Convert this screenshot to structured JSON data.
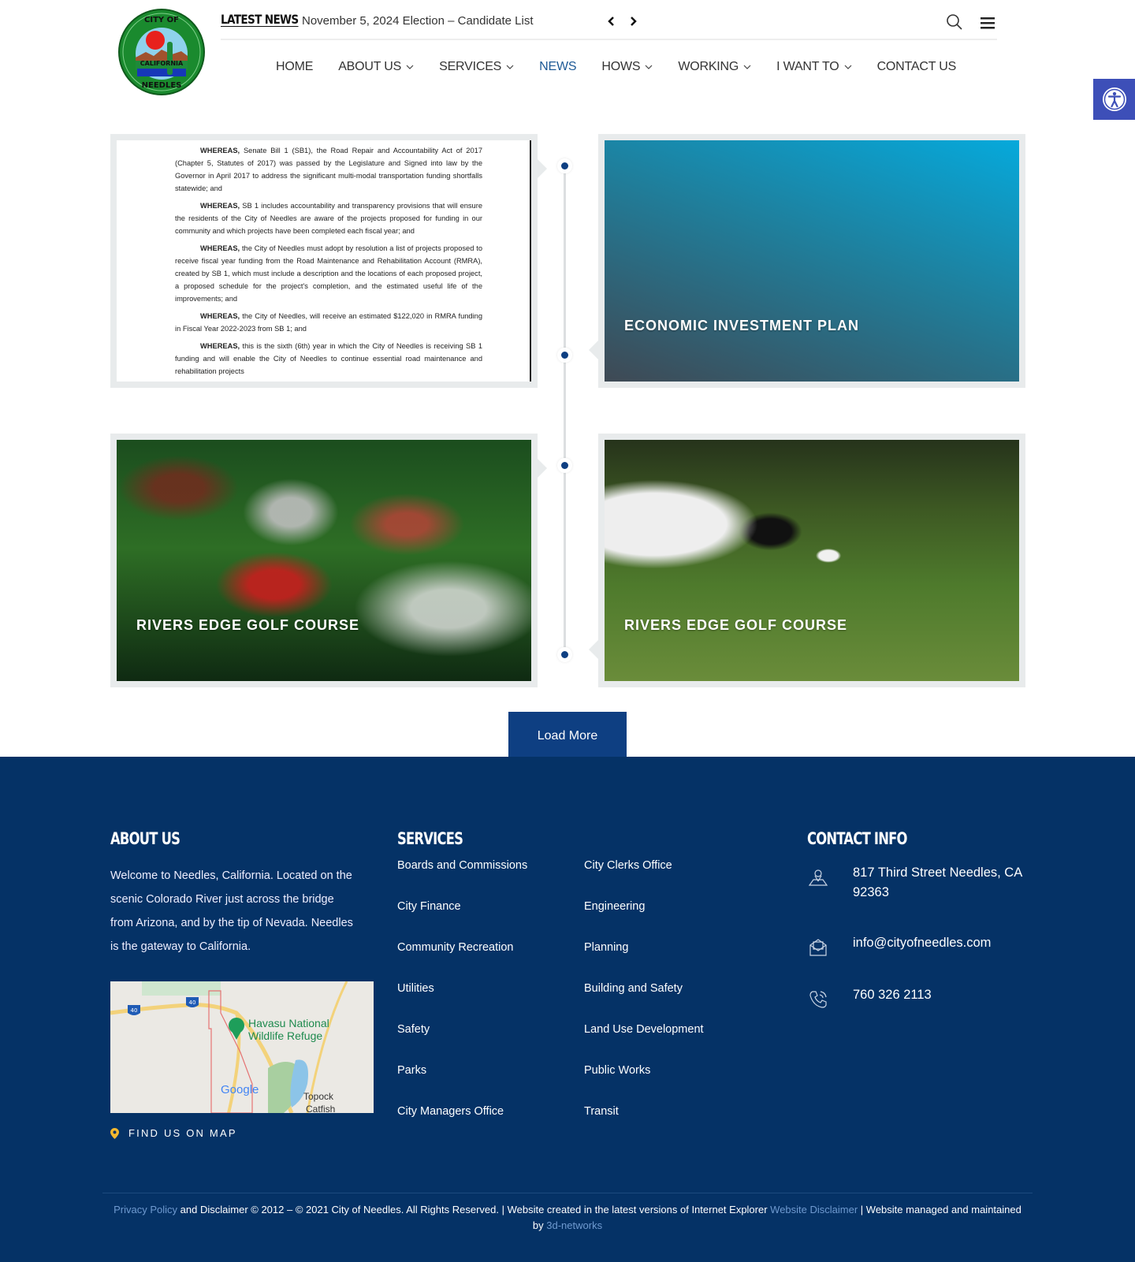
{
  "header": {
    "logo_alt": "City of Needles California seal",
    "ticker_label": "LATEST NEWS",
    "ticker_text": "November 5, 2024 Election – Candidate List"
  },
  "nav": {
    "items": [
      {
        "label": "HOME",
        "has_dropdown": false,
        "active": false
      },
      {
        "label": "ABOUT US",
        "has_dropdown": true,
        "active": false
      },
      {
        "label": "SERVICES",
        "has_dropdown": true,
        "active": false
      },
      {
        "label": "NEWS",
        "has_dropdown": false,
        "active": true
      },
      {
        "label": "HOWS",
        "has_dropdown": true,
        "active": false
      },
      {
        "label": "WORKING",
        "has_dropdown": true,
        "active": false
      },
      {
        "label": "I WANT TO",
        "has_dropdown": true,
        "active": false
      },
      {
        "label": "CONTACT US",
        "has_dropdown": false,
        "active": false
      }
    ]
  },
  "timeline": {
    "cards": [
      {
        "title": "",
        "type": "document",
        "paragraphs": [
          {
            "lead": "WHEREAS,",
            "text": " Senate Bill 1 (SB1), the Road Repair and Accountability Act of 2017 (Chapter 5, Statutes of 2017) was passed by the Legislature and Signed into law by the Governor in April 2017 to address the significant multi-modal transportation funding shortfalls statewide; and"
          },
          {
            "lead": "WHEREAS,",
            "text": " SB 1 includes accountability and transparency provisions that will ensure the residents of the City of Needles are aware of the projects proposed for funding in our community and which projects have been completed each fiscal year; and"
          },
          {
            "lead": "WHEREAS,",
            "text": " the City of Needles must adopt by resolution a list of projects proposed to receive fiscal year funding from the Road Maintenance and Rehabilitation Account (RMRA), created by SB 1, which must include a description and the locations of each proposed project, a proposed schedule for the project's completion, and the estimated useful life of the improvements; and"
          },
          {
            "lead": "WHEREAS,",
            "text": " the City of Needles, will receive an estimated $122,020 in RMRA funding in Fiscal Year 2022-2023 from SB 1; and"
          },
          {
            "lead": "WHEREAS,",
            "text": " this is the sixth (6th) year in which the City of Needles is receiving SB 1 funding and will enable the City of Needles to continue essential road maintenance and rehabilitation projects"
          }
        ]
      },
      {
        "title": "ECONOMIC INVESTMENT PLAN",
        "type": "gradient"
      },
      {
        "title": "RIVERS EDGE GOLF COURSE",
        "type": "image-golf-bag"
      },
      {
        "title": "RIVERS EDGE GOLF COURSE",
        "type": "image-golf-putt"
      }
    ],
    "load_more_label": "Load More"
  },
  "footer": {
    "about": {
      "heading": "ABOUT US",
      "text": "Welcome to Needles, California. Located on the scenic Colorado River just across the bridge from Arizona, and by the tip of Nevada. Needles is the gateway to California.",
      "map_labels": {
        "place": "Havasu National Wildlife Refuge",
        "place_line1": "Havasu National",
        "place_line2": "Wildlife Refuge",
        "town_line1": "Topock",
        "town_line2": "Catfish",
        "highway": "40",
        "brand": "Google"
      },
      "find_map_label": "FIND US ON MAP"
    },
    "services": {
      "heading": "SERVICES",
      "col1": [
        "Boards and Commissions",
        "City Finance",
        "Community Recreation",
        "Utilities",
        "Safety",
        "Parks",
        "City Managers Office"
      ],
      "col2": [
        "City Clerks Office",
        "Engineering",
        "Planning",
        "Building and Safety",
        "Land Use Development",
        "Public Works",
        "Transit"
      ]
    },
    "contact": {
      "heading": "CONTACT INFO",
      "address": "817 Third Street Needles, CA 92363",
      "email": "info@cityofneedles.com",
      "phone": "760 326 2113"
    },
    "copyright": {
      "privacy_link": "Privacy Policy",
      "text1": " and Disclaimer © 2012 – © 2021 City of Needles. All Rights Reserved. | Website created in the latest versions of Internet Explorer ",
      "disclaimer_link": "Website Disclaimer",
      "text2": " | Website managed and maintained by ",
      "networks_link": "3d-networks"
    }
  },
  "colors": {
    "brand_navy": "#053266",
    "button_blue": "#0e3f82",
    "active_nav": "#1e5a96",
    "accessibility": "#3d4fb8",
    "footer_link": "#6f9ad0"
  }
}
